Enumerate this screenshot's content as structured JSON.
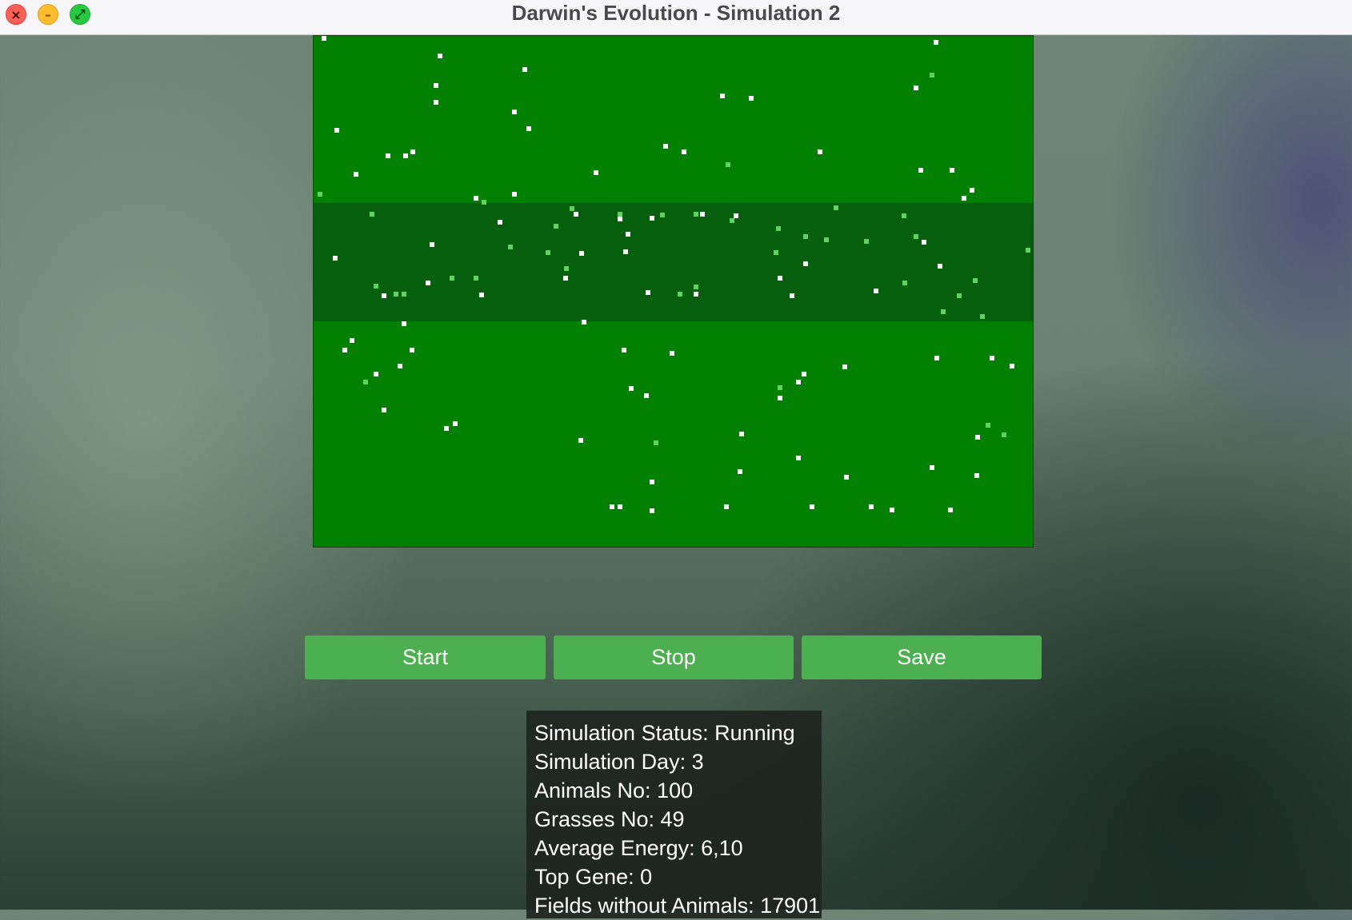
{
  "window": {
    "title": "Darwin's Evolution - Simulation 2",
    "controls": [
      "close",
      "minimize",
      "maximize"
    ]
  },
  "map": {
    "colors": {
      "steppe": "#028002",
      "jungle": "#065f0d",
      "animal": "#ffffff",
      "grass": "#5fd35f"
    }
  },
  "buttons": {
    "start": "Start",
    "stop": "Stop",
    "save": "Save"
  },
  "stats": {
    "status": "Simulation Status: Running",
    "day": "Simulation Day: 3",
    "animals": "Animals No: 100",
    "grasses": "Grasses No: 49",
    "avg_energy": "Average Energy: 6,10",
    "top_gene": "Top Gene: 0",
    "empty_fields": "Fields without Animals: 17901"
  },
  "colors": {
    "button_bg": "#4caf50",
    "button_text": "#ffffff",
    "stats_bg": "#1e2420"
  }
}
